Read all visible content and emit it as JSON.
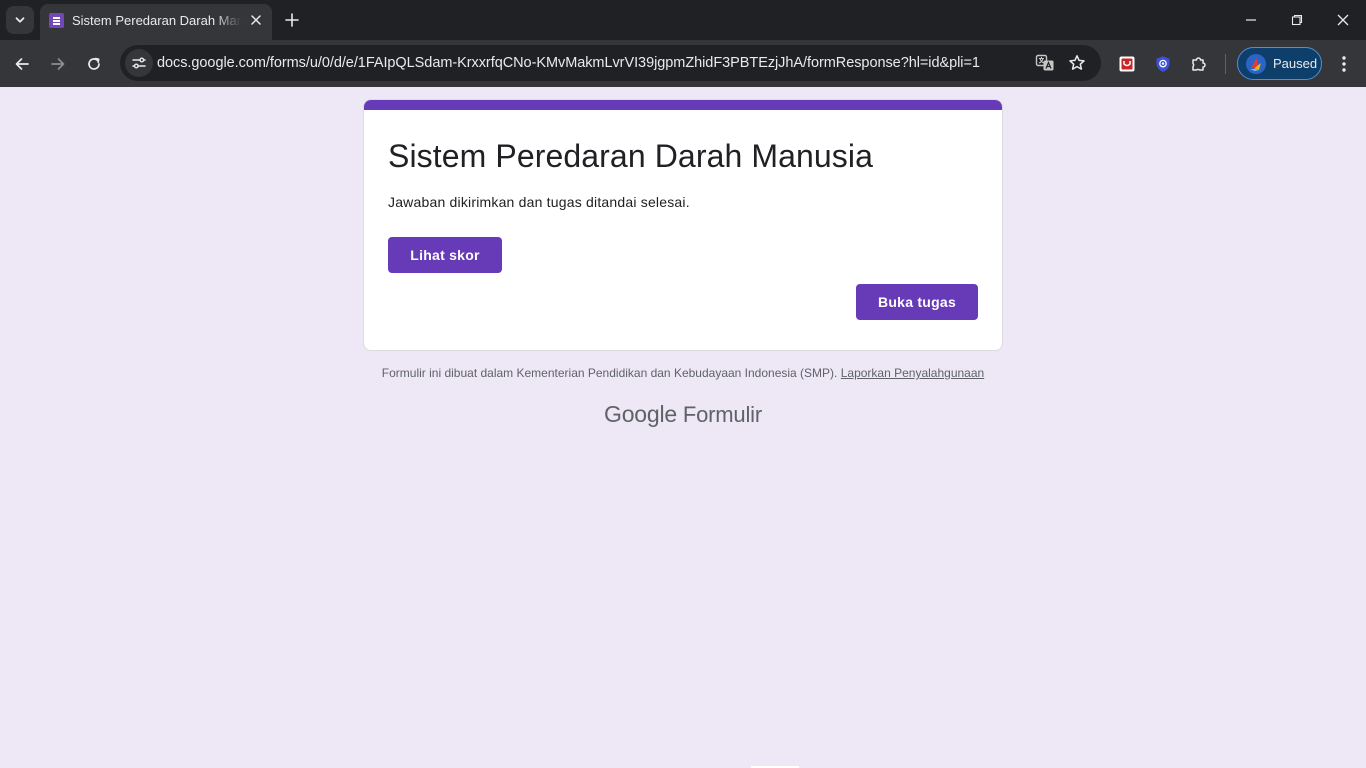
{
  "browser": {
    "tab": {
      "title": "Sistem Peredaran Darah Manusia"
    },
    "url": "docs.google.com/forms/u/0/d/e/1FAIpQLSdam-KrxxrfqCNo-KMvMakmLvrVI39jgpmZhidF3PBTEzjJhA/formResponse?hl=id&pli=1",
    "profile": {
      "label": "Paused"
    },
    "colors": {
      "tabstrip": "#202124",
      "toolbar": "#35363a",
      "profile_pill": "#0e3f6b"
    }
  },
  "form": {
    "title": "Sistem Peredaran Darah Manusia",
    "message": "Jawaban dikirimkan dan tugas ditandai selesai.",
    "view_score_label": "Lihat skor",
    "open_assignment_label": "Buka tugas"
  },
  "footer": {
    "note": "Formulir ini dibuat dalam Kementerian Pendidikan dan Kebudayaan Indonesia (SMP).",
    "report_link": "Laporkan Penyalahgunaan",
    "brand_google": "Google",
    "brand_product": "Formulir"
  },
  "colors": {
    "accent": "#673ab7",
    "background": "#ede7f6",
    "card": "#ffffff"
  }
}
